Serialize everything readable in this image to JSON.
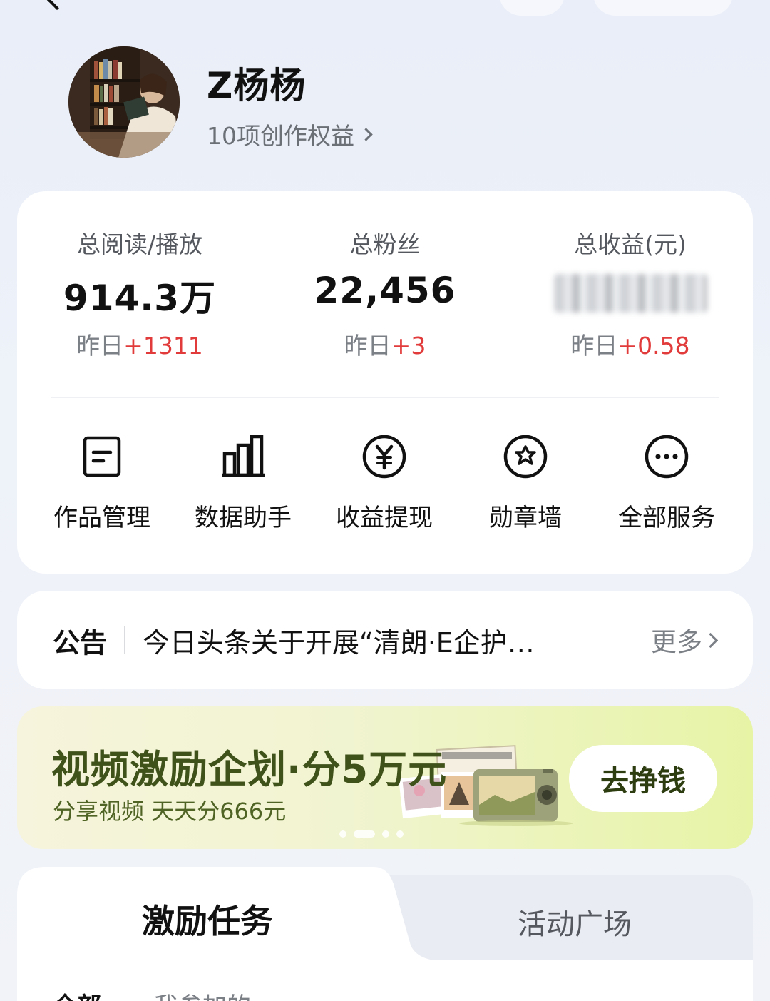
{
  "profile": {
    "username": "Z杨杨",
    "benefits_link": "10项创作权益"
  },
  "stats": [
    {
      "label": "总阅读/播放",
      "value": "914.3万",
      "delta_prefix": "昨日",
      "delta": "+1311"
    },
    {
      "label": "总粉丝",
      "value": "22,456",
      "delta_prefix": "昨日",
      "delta": "+3"
    },
    {
      "label": "总收益(元)",
      "value": "",
      "delta_prefix": "昨日",
      "delta": "+0.58"
    }
  ],
  "services": [
    {
      "label": "作品管理",
      "icon": "document-icon"
    },
    {
      "label": "数据助手",
      "icon": "bar-chart-icon"
    },
    {
      "label": "收益提现",
      "icon": "yuan-icon"
    },
    {
      "label": "勋章墙",
      "icon": "badge-star-icon"
    },
    {
      "label": "全部服务",
      "icon": "more-dots-icon"
    }
  ],
  "notice": {
    "title": "公告",
    "text": "今日头条关于开展“清朗·E企护…",
    "more": "更多"
  },
  "banner": {
    "title": "视频激励企划·分5万元",
    "subtitle": "分享视频 天天分666元",
    "button": "去挣钱",
    "page_index": 2,
    "page_count": 4
  },
  "tabs": {
    "active": "激励任务",
    "inactive": "活动广场"
  },
  "subtabs": {
    "all": "全部",
    "mine": "我参加的"
  },
  "colors": {
    "delta_red": "#e23b3b",
    "banner_title": "#3f5219",
    "page_bg": "#eef2f9"
  }
}
